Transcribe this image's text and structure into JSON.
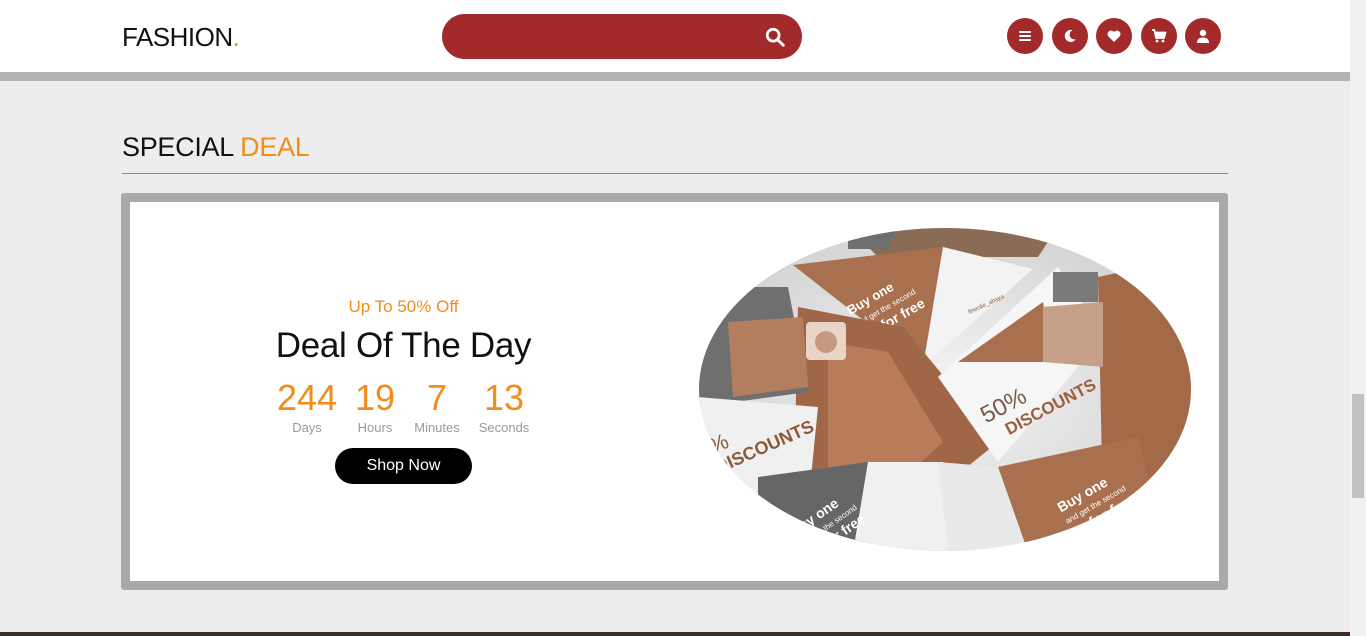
{
  "header": {
    "logo_text": "FASHION",
    "logo_dot": ".",
    "search": {
      "placeholder": "",
      "value": ""
    },
    "icons": [
      "menu-icon",
      "moon-icon",
      "heart-icon",
      "cart-icon",
      "user-icon"
    ]
  },
  "section": {
    "title_main": "SPECIAL",
    "title_accent": "DEAL"
  },
  "deal": {
    "subtitle": "Up To 50% Off",
    "title": "Deal Of The Day",
    "countdown": [
      {
        "value": "244",
        "label": "Days"
      },
      {
        "value": "19",
        "label": "Hours"
      },
      {
        "value": "7",
        "label": "Minutes"
      },
      {
        "value": "13",
        "label": "Seconds"
      }
    ],
    "button_label": "Shop Now",
    "image_text": {
      "buy_one": "Buy one",
      "get_second": "and get the second",
      "for_free": "for free",
      "percent": "50%",
      "discounts": "DISCOUNTS",
      "brand": "fineolie_abaya"
    }
  },
  "colors": {
    "brand_red": "#a22a2a",
    "accent_orange": "#f28c1c",
    "product_brown": "#a9704f"
  }
}
